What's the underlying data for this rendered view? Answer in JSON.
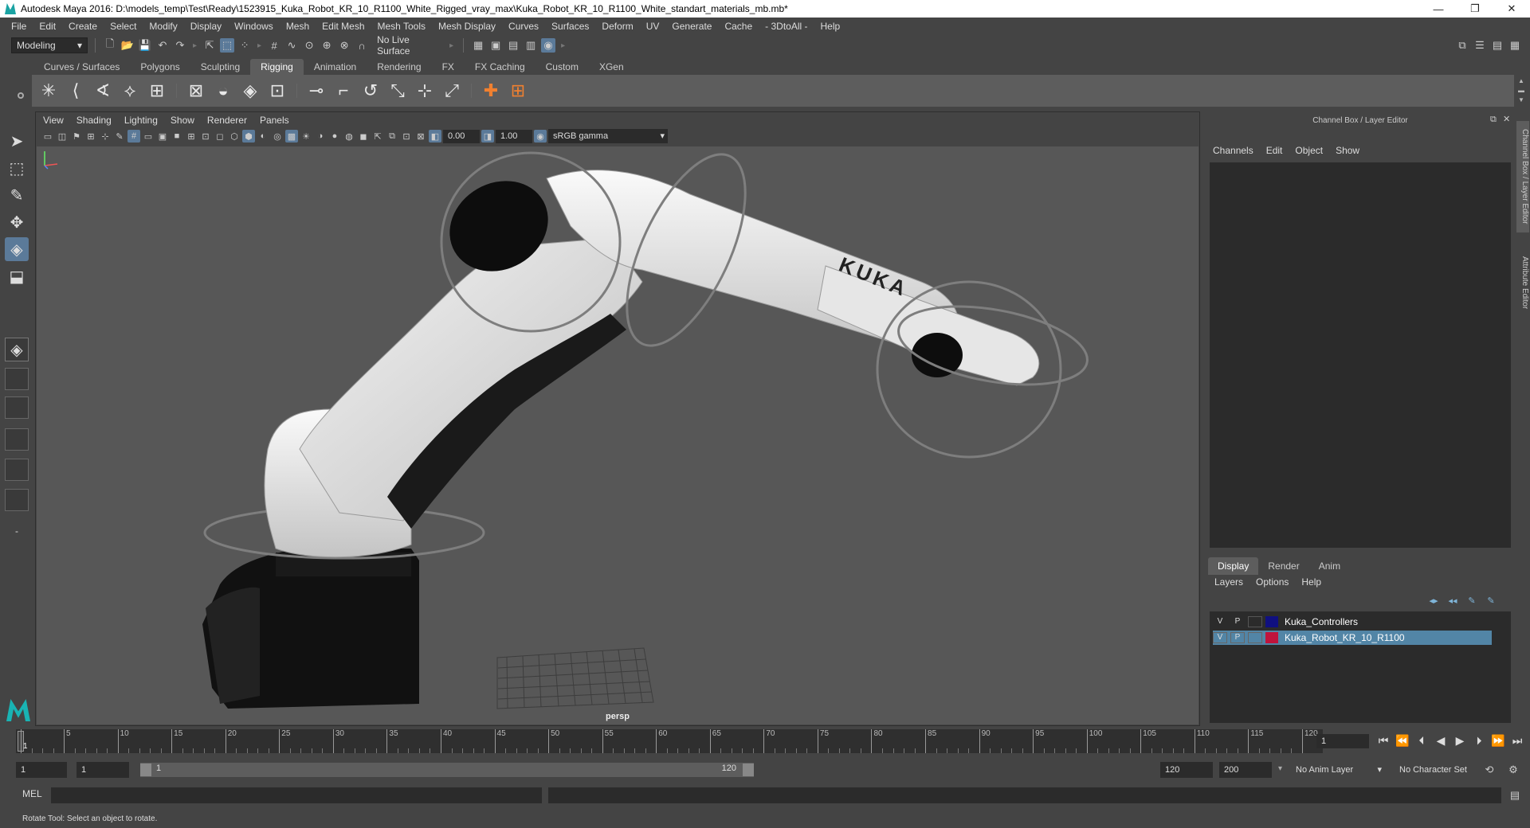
{
  "window": {
    "title": "Autodesk Maya 2016: D:\\models_temp\\Test\\Ready\\1523915_Kuka_Robot_KR_10_R1100_White_Rigged_vray_max\\Kuka_Robot_KR_10_R1100_White_standart_materials_mb.mb*",
    "minimize": "—",
    "restore": "❐",
    "close": "✕"
  },
  "menubar": [
    "File",
    "Edit",
    "Create",
    "Select",
    "Modify",
    "Display",
    "Windows",
    "Mesh",
    "Edit Mesh",
    "Mesh Tools",
    "Mesh Display",
    "Curves",
    "Surfaces",
    "Deform",
    "UV",
    "Generate",
    "Cache",
    "- 3DtoAll -",
    "Help"
  ],
  "statusline": {
    "mode": "Modeling",
    "live_surface": "No Live Surface"
  },
  "shelf": {
    "tabs": [
      "Curves / Surfaces",
      "Polygons",
      "Sculpting",
      "Rigging",
      "Animation",
      "Rendering",
      "FX",
      "FX Caching",
      "Custom",
      "XGen"
    ],
    "active_tab": "Rigging"
  },
  "panel": {
    "menu": [
      "View",
      "Shading",
      "Lighting",
      "Show",
      "Renderer",
      "Panels"
    ],
    "exposure": "0.00",
    "gamma": "1.00",
    "colorspace": "sRGB gamma",
    "camera": "persp",
    "model_logo": "KUKA"
  },
  "channel_box": {
    "title": "Channel Box / Layer Editor",
    "menu": [
      "Channels",
      "Edit",
      "Object",
      "Show"
    ],
    "side_tabs": [
      "Channel Box / Layer Editor",
      "Attribute Editor"
    ]
  },
  "layer_editor": {
    "tabs": [
      "Display",
      "Render",
      "Anim"
    ],
    "active_tab": "Display",
    "menu": [
      "Layers",
      "Options",
      "Help"
    ],
    "layers": [
      {
        "v": "V",
        "p": "P",
        "color": "#101080",
        "name": "Kuka_Controllers",
        "selected": false
      },
      {
        "v": "V",
        "p": "P",
        "color": "#c0143c",
        "name": "Kuka_Robot_KR_10_R1100",
        "selected": true
      }
    ]
  },
  "timeline": {
    "labels": [
      "1",
      "5",
      "10",
      "15",
      "20",
      "25",
      "30",
      "35",
      "40",
      "45",
      "50",
      "55",
      "60",
      "65",
      "70",
      "75",
      "80",
      "85",
      "90",
      "95",
      "100",
      "105",
      "110",
      "115",
      "120"
    ],
    "current_frame": "1"
  },
  "range": {
    "start": "1",
    "playback_start": "1",
    "slider_start": "1",
    "slider_end": "120",
    "playback_end": "120",
    "end": "200",
    "anim_layer": "No Anim Layer",
    "character_set": "No Character Set"
  },
  "cmdline": {
    "label": "MEL"
  },
  "helpline": {
    "text": "Rotate Tool: Select an object to rotate."
  }
}
